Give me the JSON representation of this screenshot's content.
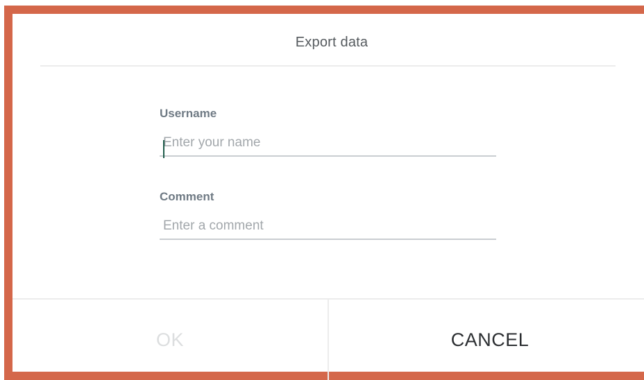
{
  "dialog": {
    "title": "Export data"
  },
  "form": {
    "username": {
      "label": "Username",
      "placeholder": "Enter your name",
      "value": ""
    },
    "comment": {
      "label": "Comment",
      "placeholder": "Enter a comment",
      "value": ""
    }
  },
  "actions": {
    "ok_label": "OK",
    "ok_enabled": false,
    "cancel_label": "CANCEL"
  },
  "colors": {
    "frame_border": "#d4674a",
    "caret": "#1f5c4a",
    "disabled_text": "#dcdedf"
  }
}
